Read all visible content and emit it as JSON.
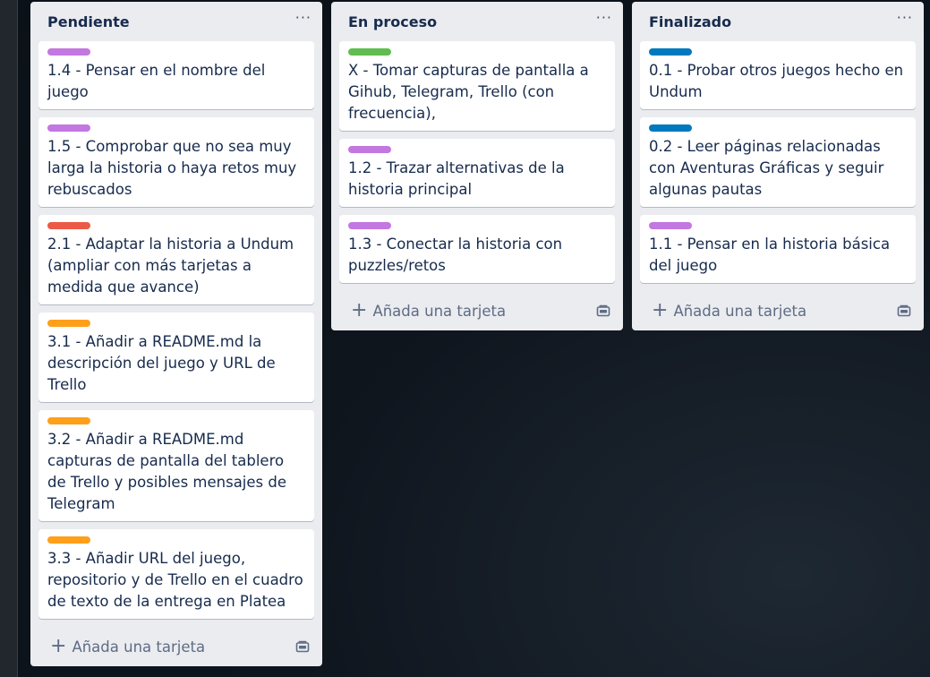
{
  "colors": {
    "purple": "#c377e0",
    "red": "#eb5a46",
    "orange": "#ff9f1a",
    "green": "#61bd4f",
    "blue": "#0079bf"
  },
  "icons": {
    "more": "dots-icon",
    "add": "plus-icon",
    "template": "card-template-icon"
  },
  "lists": [
    {
      "title": "Pendiente",
      "more": "···",
      "add_label": "Añada una tarjeta",
      "cards": [
        {
          "label_color": "purple",
          "text": "1.4 - Pensar en el nombre del juego"
        },
        {
          "label_color": "purple",
          "text": "1.5 - Comprobar que no sea muy larga la historia o haya retos muy rebuscados"
        },
        {
          "label_color": "red",
          "text": "2.1 - Adaptar la historia a Undum (ampliar con más tarjetas a medida que avance)"
        },
        {
          "label_color": "orange",
          "text": "3.1 - Añadir a README.md la descripción del juego y URL de Trello"
        },
        {
          "label_color": "orange",
          "text": "3.2 - Añadir a README.md capturas de pantalla del tablero de Trello y posibles mensajes de Telegram"
        },
        {
          "label_color": "orange",
          "text": "3.3 - Añadir URL del juego, repositorio y de Trello en el cuadro de texto de la entrega en Platea"
        }
      ]
    },
    {
      "title": "En proceso",
      "more": "···",
      "add_label": "Añada una tarjeta",
      "cards": [
        {
          "label_color": "green",
          "text": "X - Tomar capturas de pantalla a Gihub, Telegram, Trello (con frecuencia),"
        },
        {
          "label_color": "purple",
          "text": "1.2 - Trazar alternativas de la historia principal"
        },
        {
          "label_color": "purple",
          "text": "1.3 - Conectar la historia con puzzles/retos"
        }
      ]
    },
    {
      "title": "Finalizado",
      "more": "···",
      "add_label": "Añada una tarjeta",
      "cards": [
        {
          "label_color": "blue",
          "text": "0.1 - Probar otros juegos hecho en Undum"
        },
        {
          "label_color": "blue",
          "text": "0.2 - Leer páginas relacionadas con Aventuras Gráficas y seguir algunas pautas"
        },
        {
          "label_color": "purple",
          "text": "1.1 - Pensar en la historia básica del juego"
        }
      ]
    }
  ]
}
